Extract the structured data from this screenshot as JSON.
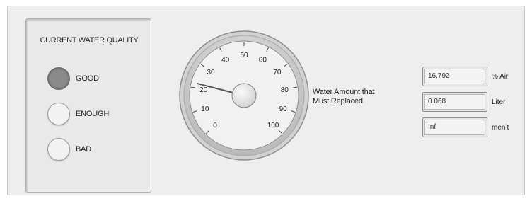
{
  "quality": {
    "title": "CURRENT WATER QUALITY",
    "indicators": [
      {
        "label": "GOOD",
        "on": true
      },
      {
        "label": "ENOUGH",
        "on": false
      },
      {
        "label": "BAD",
        "on": false
      }
    ]
  },
  "gauge": {
    "label_line1": "Water Amount that",
    "label_line2": "Must Replaced",
    "min": 0,
    "max": 100,
    "value": 22,
    "ticks": [
      "0",
      "10",
      "20",
      "30",
      "40",
      "50",
      "60",
      "70",
      "80",
      "90",
      "100"
    ]
  },
  "readouts": [
    {
      "value": "16.792",
      "unit": "% Air"
    },
    {
      "value": "0.068",
      "unit": "Liter"
    },
    {
      "value": "Inf",
      "unit": "menit"
    }
  ]
}
